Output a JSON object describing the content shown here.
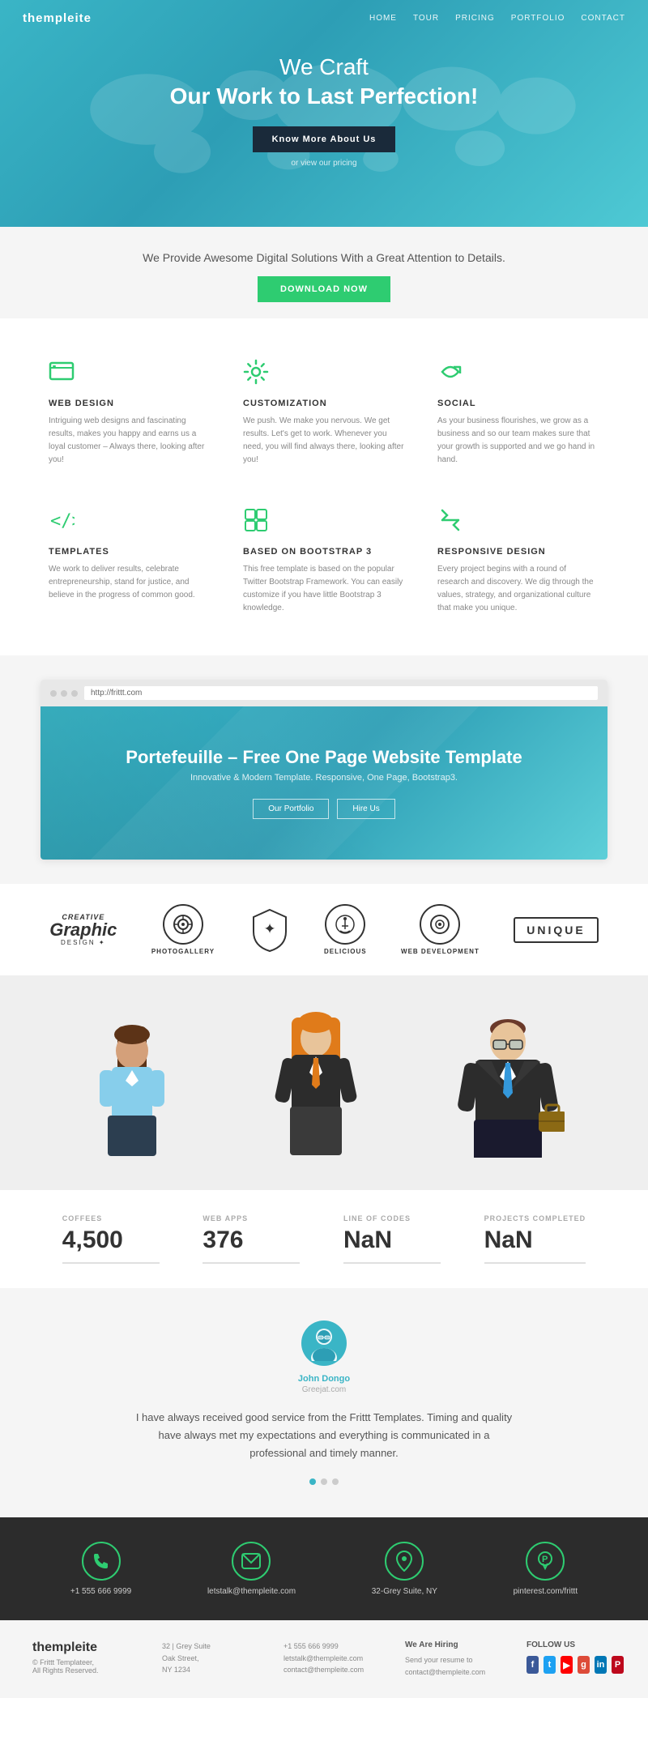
{
  "nav": {
    "logo": "thempleite",
    "links": [
      "HOME",
      "TOUR",
      "PRICING",
      "PORTFOLIO",
      "CONTACT"
    ]
  },
  "hero": {
    "headline1": "We Craft",
    "headline2": "Our Work to Last Perfection!",
    "cta_button": "Know More About Us",
    "cta_link": "or view our pricing"
  },
  "tagline": {
    "text": "We Provide Awesome Digital Solutions With a Great Attention to Details.",
    "button": "DOWNLOAD NOW"
  },
  "features": [
    {
      "icon": "▬",
      "title": "WEB DESIGN",
      "desc": "Intriguing web designs and fascinating results, makes you happy and earns us a loyal customer – Always there, looking after you!"
    },
    {
      "icon": "⚙",
      "title": "CUSTOMIZATION",
      "desc": "We push. We make you nervous. We get results. Let's get to work. Whenever you need, you will find always there, looking after you!"
    },
    {
      "icon": "↩",
      "title": "SOCIAL",
      "desc": "As your business flourishes, we grow as a business and so our team makes sure that your growth is supported and we go hand in hand."
    },
    {
      "icon": "</>",
      "title": "TEMPLATES",
      "desc": "We work to deliver results, celebrate entrepreneurship, stand for justice, and believe in the progress of common good."
    },
    {
      "icon": "⊞",
      "title": "BASED ON BOOTSTRAP 3",
      "desc": "This free template is based on the popular Twitter Bootstrap Framework. You can easily customize if you have little Bootstrap 3 knowledge."
    },
    {
      "icon": "↔",
      "title": "RESPONSIVE DESIGN",
      "desc": "Every project begins with a round of research and discovery. We dig through the values, strategy, and organizational culture that make you unique."
    }
  ],
  "portfolio": {
    "url": "http://frittt.com",
    "title": "Portefeuille – Free One Page Website Template",
    "subtitle": "Innovative & Modern Template. Responsive, One Page, Bootstrap3.",
    "btn1": "Our Portfolio",
    "btn2": "Hire Us"
  },
  "brands": [
    {
      "label": "CREATIVE",
      "sub": "Graphic DESIGN",
      "shape": "★"
    },
    {
      "label": "PHOTOGALLERY",
      "sub": "",
      "shape": "◎"
    },
    {
      "label": "",
      "sub": "",
      "shape": "✦"
    },
    {
      "label": "DELICIOUS",
      "sub": "",
      "shape": "⏱"
    },
    {
      "label": "WEB DEVELOPMENT",
      "sub": "",
      "shape": "⊙"
    },
    {
      "label": "UNIQUE",
      "sub": "",
      "shape": "◆"
    }
  ],
  "stats": [
    {
      "label": "COFFEES",
      "value": "4,500"
    },
    {
      "label": "WEB APPS",
      "value": "376"
    },
    {
      "label": "LINE OF CODES",
      "value": "NaN"
    },
    {
      "label": "PROJECTS COMPLETED",
      "value": "NaN"
    }
  ],
  "testimonial": {
    "avatar_icon": "👤",
    "name": "John Dongo",
    "site": "Greejat.com",
    "text": "I have always received good service from the Frittt Templates. Timing and quality have always met my expectations and everything is communicated in a professional and timely manner.",
    "dots": 3,
    "active_dot": 0
  },
  "contact": [
    {
      "icon": "📞",
      "type": "phone",
      "label": "+1 555 666 9999"
    },
    {
      "icon": "✉",
      "type": "email",
      "label": "letstalk@thempleite.com"
    },
    {
      "icon": "📍",
      "type": "location",
      "label": "32-Grey Suite, NY"
    },
    {
      "icon": "🅿",
      "type": "social",
      "label": "pinterest.com/frittt"
    }
  ],
  "footer": {
    "logo": "thempleite",
    "copyright": "© Frittt Templateer, All Rights Reserved.",
    "address_title": "",
    "address": "32 | Grey Suite\nOak Street,\nNY 1234",
    "phone_title": "",
    "phone": "+1 555 666 9999\nletstalk@thempleite.com\ncontact@thempleite.com",
    "hiring_title": "We Are Hiring",
    "hiring_text": "Send you resume to\ncontact@thempleite.com",
    "follow_title": "FOLLOW US",
    "social_links": [
      "f",
      "t",
      "▶",
      "g+",
      "in",
      "P"
    ]
  }
}
